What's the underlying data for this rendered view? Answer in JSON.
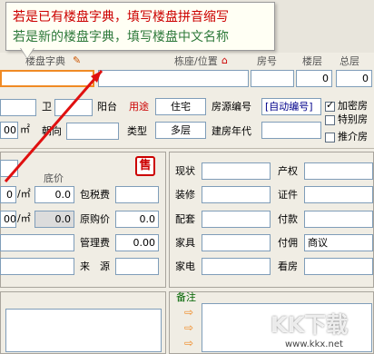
{
  "tooltip": {
    "line1": "若是已有楼盘字典，填写楼盘拼音缩写",
    "line2": "若是新的楼盘字典，填写楼盘中文名称"
  },
  "header": {
    "col_loupan": "楼盘字典",
    "col_dong": "栋座/位置",
    "col_fanghao": "房号",
    "col_louceng": "楼层",
    "col_zongceng": "总层",
    "louceng_value": "0",
    "zongceng_value": "0"
  },
  "row2": {
    "wei_label": "卫",
    "yangtai_label": "阳台",
    "yongtu_label": "用途",
    "yongtu_value": "住宅",
    "fangyuan_label": "房源编号",
    "fangyuan_value": "[自动编号]",
    "jiami_label": "加密房"
  },
  "row3": {
    "area_value": "00",
    "area_unit": "㎡",
    "chaoxiang_label": "朝向",
    "leixing_label": "类型",
    "leixing_value": "多层",
    "niandai_label": "建房年代",
    "tebie_label": "特别房"
  },
  "tuijie_label": "推介房",
  "sale_icon": "售",
  "left_panel": {
    "dijia_label": "底价",
    "price1": "0",
    "unit1": "/㎡",
    "price2": "0.0",
    "baoshui_label": "包税费",
    "price3": "00",
    "unit3": "/㎡",
    "price4": "0.0",
    "yuangou_label": "原购价",
    "yuangou_value": "0.0",
    "guanli_label": "管理费",
    "guanli_value": "0.00",
    "laiyuan_label": "来　源"
  },
  "right_panel": {
    "xianzhuang": "现状",
    "chanquan": "产权",
    "zhuangxiu": "装修",
    "zhengjian": "证件",
    "peitao": "配套",
    "fukuan": "付款",
    "jiaju": "家具",
    "fuyong": "付佣",
    "fuyong_value": "商议",
    "jiadian": "家电",
    "kanfang": "看房",
    "beizhu": "备注"
  },
  "watermark": {
    "main": "KK下载",
    "url": "www.kkx.net"
  },
  "colors": {
    "accent_red": "#cc0000",
    "tooltip_green": "#2f7a3c",
    "highlight_orange": "#f08a24"
  }
}
